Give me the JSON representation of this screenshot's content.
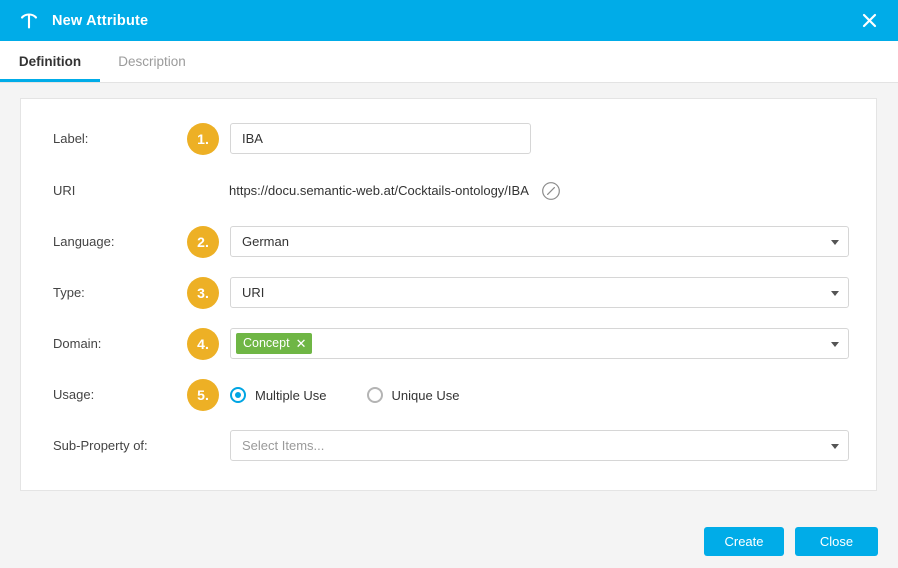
{
  "window": {
    "icon": "attribute-t-icon",
    "title": "New Attribute",
    "close_icon": "close-icon"
  },
  "tabs": [
    {
      "label": "Definition",
      "active": true
    },
    {
      "label": "Description",
      "active": false
    }
  ],
  "form": {
    "fields": {
      "label": {
        "label": "Label:",
        "badge": "1.",
        "value": "IBA",
        "placeholder": ""
      },
      "uri": {
        "label": "URI",
        "value": "https://docu.semantic-web.at/Cocktails-ontology/IBA",
        "edit_icon": "edit-uri-icon"
      },
      "language": {
        "label": "Language:",
        "badge": "2.",
        "value": "German"
      },
      "type": {
        "label": "Type:",
        "badge": "3.",
        "value": "URI"
      },
      "domain": {
        "label": "Domain:",
        "badge": "4.",
        "tags": [
          {
            "text": "Concept",
            "remove_icon": "✕"
          }
        ]
      },
      "usage": {
        "label": "Usage:",
        "badge": "5.",
        "options": [
          {
            "label": "Multiple Use",
            "selected": true
          },
          {
            "label": "Unique Use",
            "selected": false
          }
        ]
      },
      "sub_property": {
        "label": "Sub-Property of:",
        "value": "",
        "placeholder": "Select Items..."
      }
    }
  },
  "footer": {
    "create_label": "Create",
    "close_label": "Close"
  },
  "colors": {
    "header_blue": "#00ace8",
    "badge_orange": "#edb025",
    "tag_green": "#6fb645",
    "radio_blue": "#00a5e3",
    "page_bg": "#f4f4f4"
  }
}
